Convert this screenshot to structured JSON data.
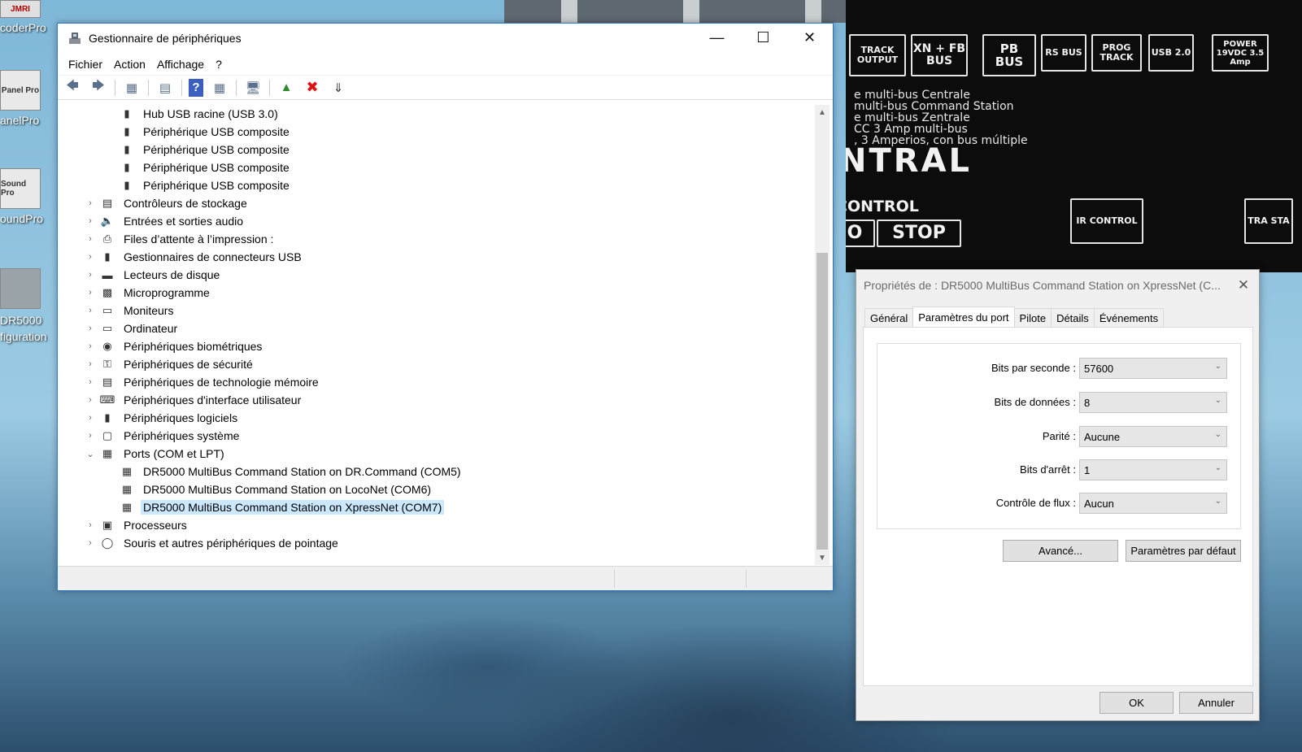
{
  "desktop": {
    "icons": [
      {
        "label": "coderPro",
        "badge": "JMRI"
      },
      {
        "label": "anelPro",
        "badge": "Panel Pro"
      },
      {
        "label": "oundPro",
        "badge": "Sound Pro"
      },
      {
        "label": "DR5000\nfiguration",
        "badge": ""
      }
    ],
    "hardware": {
      "boxes": [
        "TRACK OUTPUT",
        "XN + FB BUS",
        "PB BUS",
        "RS BUS",
        "PROG TRACK",
        "USB 2.0",
        "POWER 19VDC 3.5 Amp"
      ],
      "lines": "e multi-bus Centrale\nmulti-bus Command Station\ne multi-bus Zentrale\nCC 3 Amp multi-bus\n, 3 Amperios, con bus múltiple",
      "big": "NTRAL",
      "control": "CONTROL",
      "stop": "STOP",
      "o": "O",
      "ir": "IR CONTROL",
      "tra": "TRA STA"
    }
  },
  "device_manager": {
    "title": "Gestionnaire de périphériques",
    "menu": [
      "Fichier",
      "Action",
      "Affichage",
      "?"
    ],
    "tree": [
      {
        "level": 1,
        "label": "Hub USB racine (USB 3.0)",
        "icon": "usb-plug-icon"
      },
      {
        "level": 1,
        "label": "Périphérique USB composite",
        "icon": "usb-plug-icon"
      },
      {
        "level": 1,
        "label": "Périphérique USB composite",
        "icon": "usb-plug-icon"
      },
      {
        "level": 1,
        "label": "Périphérique USB composite",
        "icon": "usb-plug-icon"
      },
      {
        "level": 1,
        "label": "Périphérique USB composite",
        "icon": "usb-plug-icon"
      },
      {
        "level": 0,
        "label": "Contrôleurs de stockage",
        "icon": "storage-icon",
        "expanded": false
      },
      {
        "level": 0,
        "label": "Entrées et sorties audio",
        "icon": "speaker-icon",
        "expanded": false
      },
      {
        "level": 0,
        "label": "Files d’attente à l’impression :",
        "icon": "printer-icon",
        "expanded": false
      },
      {
        "level": 0,
        "label": "Gestionnaires de connecteurs USB",
        "icon": "usb-plug-icon",
        "expanded": false
      },
      {
        "level": 0,
        "label": "Lecteurs de disque",
        "icon": "disk-icon",
        "expanded": false
      },
      {
        "level": 0,
        "label": "Microprogramme",
        "icon": "chip-icon",
        "expanded": false
      },
      {
        "level": 0,
        "label": "Moniteurs",
        "icon": "monitor-icon",
        "expanded": false
      },
      {
        "level": 0,
        "label": "Ordinateur",
        "icon": "computer-icon",
        "expanded": false
      },
      {
        "level": 0,
        "label": "Périphériques biométriques",
        "icon": "fingerprint-icon",
        "expanded": false
      },
      {
        "level": 0,
        "label": "Périphériques de sécurité",
        "icon": "key-icon",
        "expanded": false
      },
      {
        "level": 0,
        "label": "Périphériques de technologie mémoire",
        "icon": "memory-icon",
        "expanded": false
      },
      {
        "level": 0,
        "label": "Périphériques d'interface utilisateur",
        "icon": "hid-icon",
        "expanded": false
      },
      {
        "level": 0,
        "label": "Périphériques logiciels",
        "icon": "software-device-icon",
        "expanded": false
      },
      {
        "level": 0,
        "label": "Périphériques système",
        "icon": "system-folder-icon",
        "expanded": false
      },
      {
        "level": 0,
        "label": "Ports (COM et LPT)",
        "icon": "port-icon",
        "expanded": true
      },
      {
        "level": 1,
        "label": "DR5000 MultiBus Command Station on DR.Command (COM5)",
        "icon": "port-icon"
      },
      {
        "level": 1,
        "label": "DR5000 MultiBus Command Station on LocoNet (COM6)",
        "icon": "port-icon"
      },
      {
        "level": 1,
        "label": "DR5000 MultiBus Command Station on XpressNet (COM7)",
        "icon": "port-icon",
        "selected": true
      },
      {
        "level": 0,
        "label": "Processeurs",
        "icon": "processor-icon",
        "expanded": false
      },
      {
        "level": 0,
        "label": "Souris et autres périphériques de pointage",
        "icon": "mouse-icon",
        "expanded": false
      }
    ]
  },
  "properties": {
    "title": "Propriétés de : DR5000 MultiBus Command Station on XpressNet (C...",
    "tabs": [
      "Général",
      "Paramètres du port",
      "Pilote",
      "Détails",
      "Événements"
    ],
    "active_tab": "Paramètres du port",
    "fields": [
      {
        "label": "Bits par seconde :",
        "value": "57600"
      },
      {
        "label": "Bits de données :",
        "value": "8"
      },
      {
        "label": "Parité :",
        "value": "Aucune"
      },
      {
        "label": "Bits d'arrêt :",
        "value": "1"
      },
      {
        "label": "Contrôle de flux :",
        "value": "Aucun"
      }
    ],
    "advanced_label": "Avancé...",
    "defaults_label": "Paramètres par défaut",
    "ok_label": "OK",
    "cancel_label": "Annuler"
  }
}
